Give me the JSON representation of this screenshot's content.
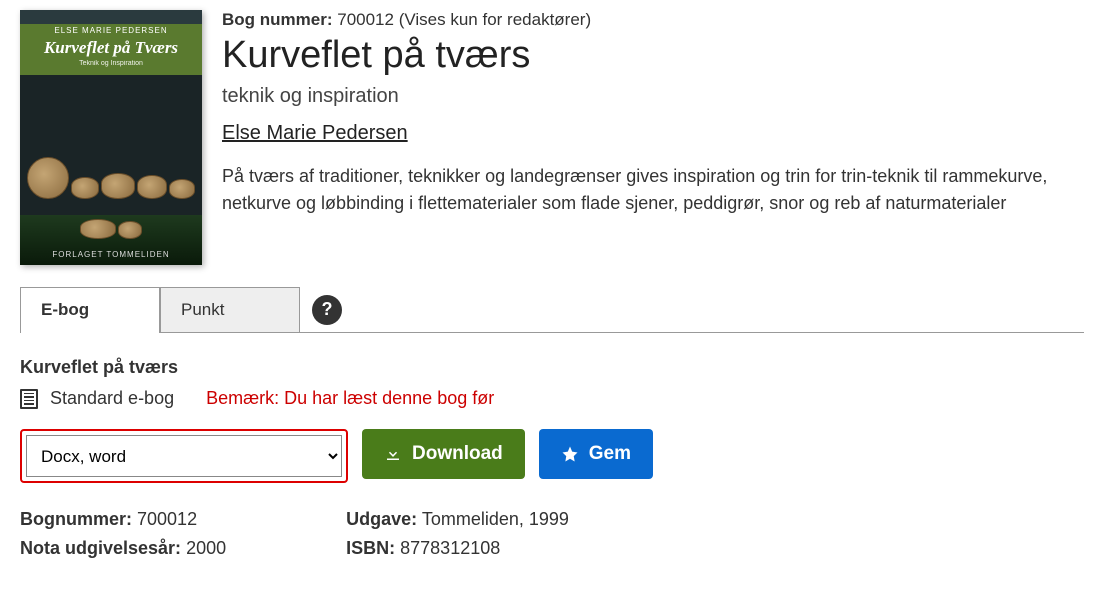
{
  "cover": {
    "author_caps": "ELSE MARIE PEDERSEN",
    "title": "Kurveflet på Tværs",
    "subtitle": "Teknik og Inspiration",
    "publisher_caps": "FORLAGET TOMMELIDEN"
  },
  "header": {
    "book_number_label": "Bog nummer:",
    "book_number_value": "700012",
    "book_number_note": "(Vises kun for redaktører)",
    "title": "Kurveflet på tværs",
    "subtitle": "teknik og inspiration",
    "author": "Else Marie Pedersen",
    "description": "På tværs af traditioner, teknikker og landegrænser gives inspiration og trin for trin-teknik til rammekurve, netkurve og løbbinding i flettematerialer som flade sjener, peddigrør, snor og reb af naturmaterialer"
  },
  "tabs": {
    "ebook": "E-bog",
    "punkt": "Punkt",
    "help": "?"
  },
  "ebook_section": {
    "title": "Kurveflet på tværs",
    "format_label": "Standard e-bog",
    "notice": "Bemærk: Du har læst denne bog før",
    "select_value": "Docx, word",
    "download_label": "Download",
    "save_label": "Gem"
  },
  "details": {
    "bognummer_label": "Bognummer:",
    "bognummer_value": "700012",
    "udgivelsesar_label": "Nota udgivelsesår:",
    "udgivelsesar_value": "2000",
    "udgave_label": "Udgave:",
    "udgave_value": "Tommeliden, 1999",
    "isbn_label": "ISBN:",
    "isbn_value": "8778312108"
  }
}
